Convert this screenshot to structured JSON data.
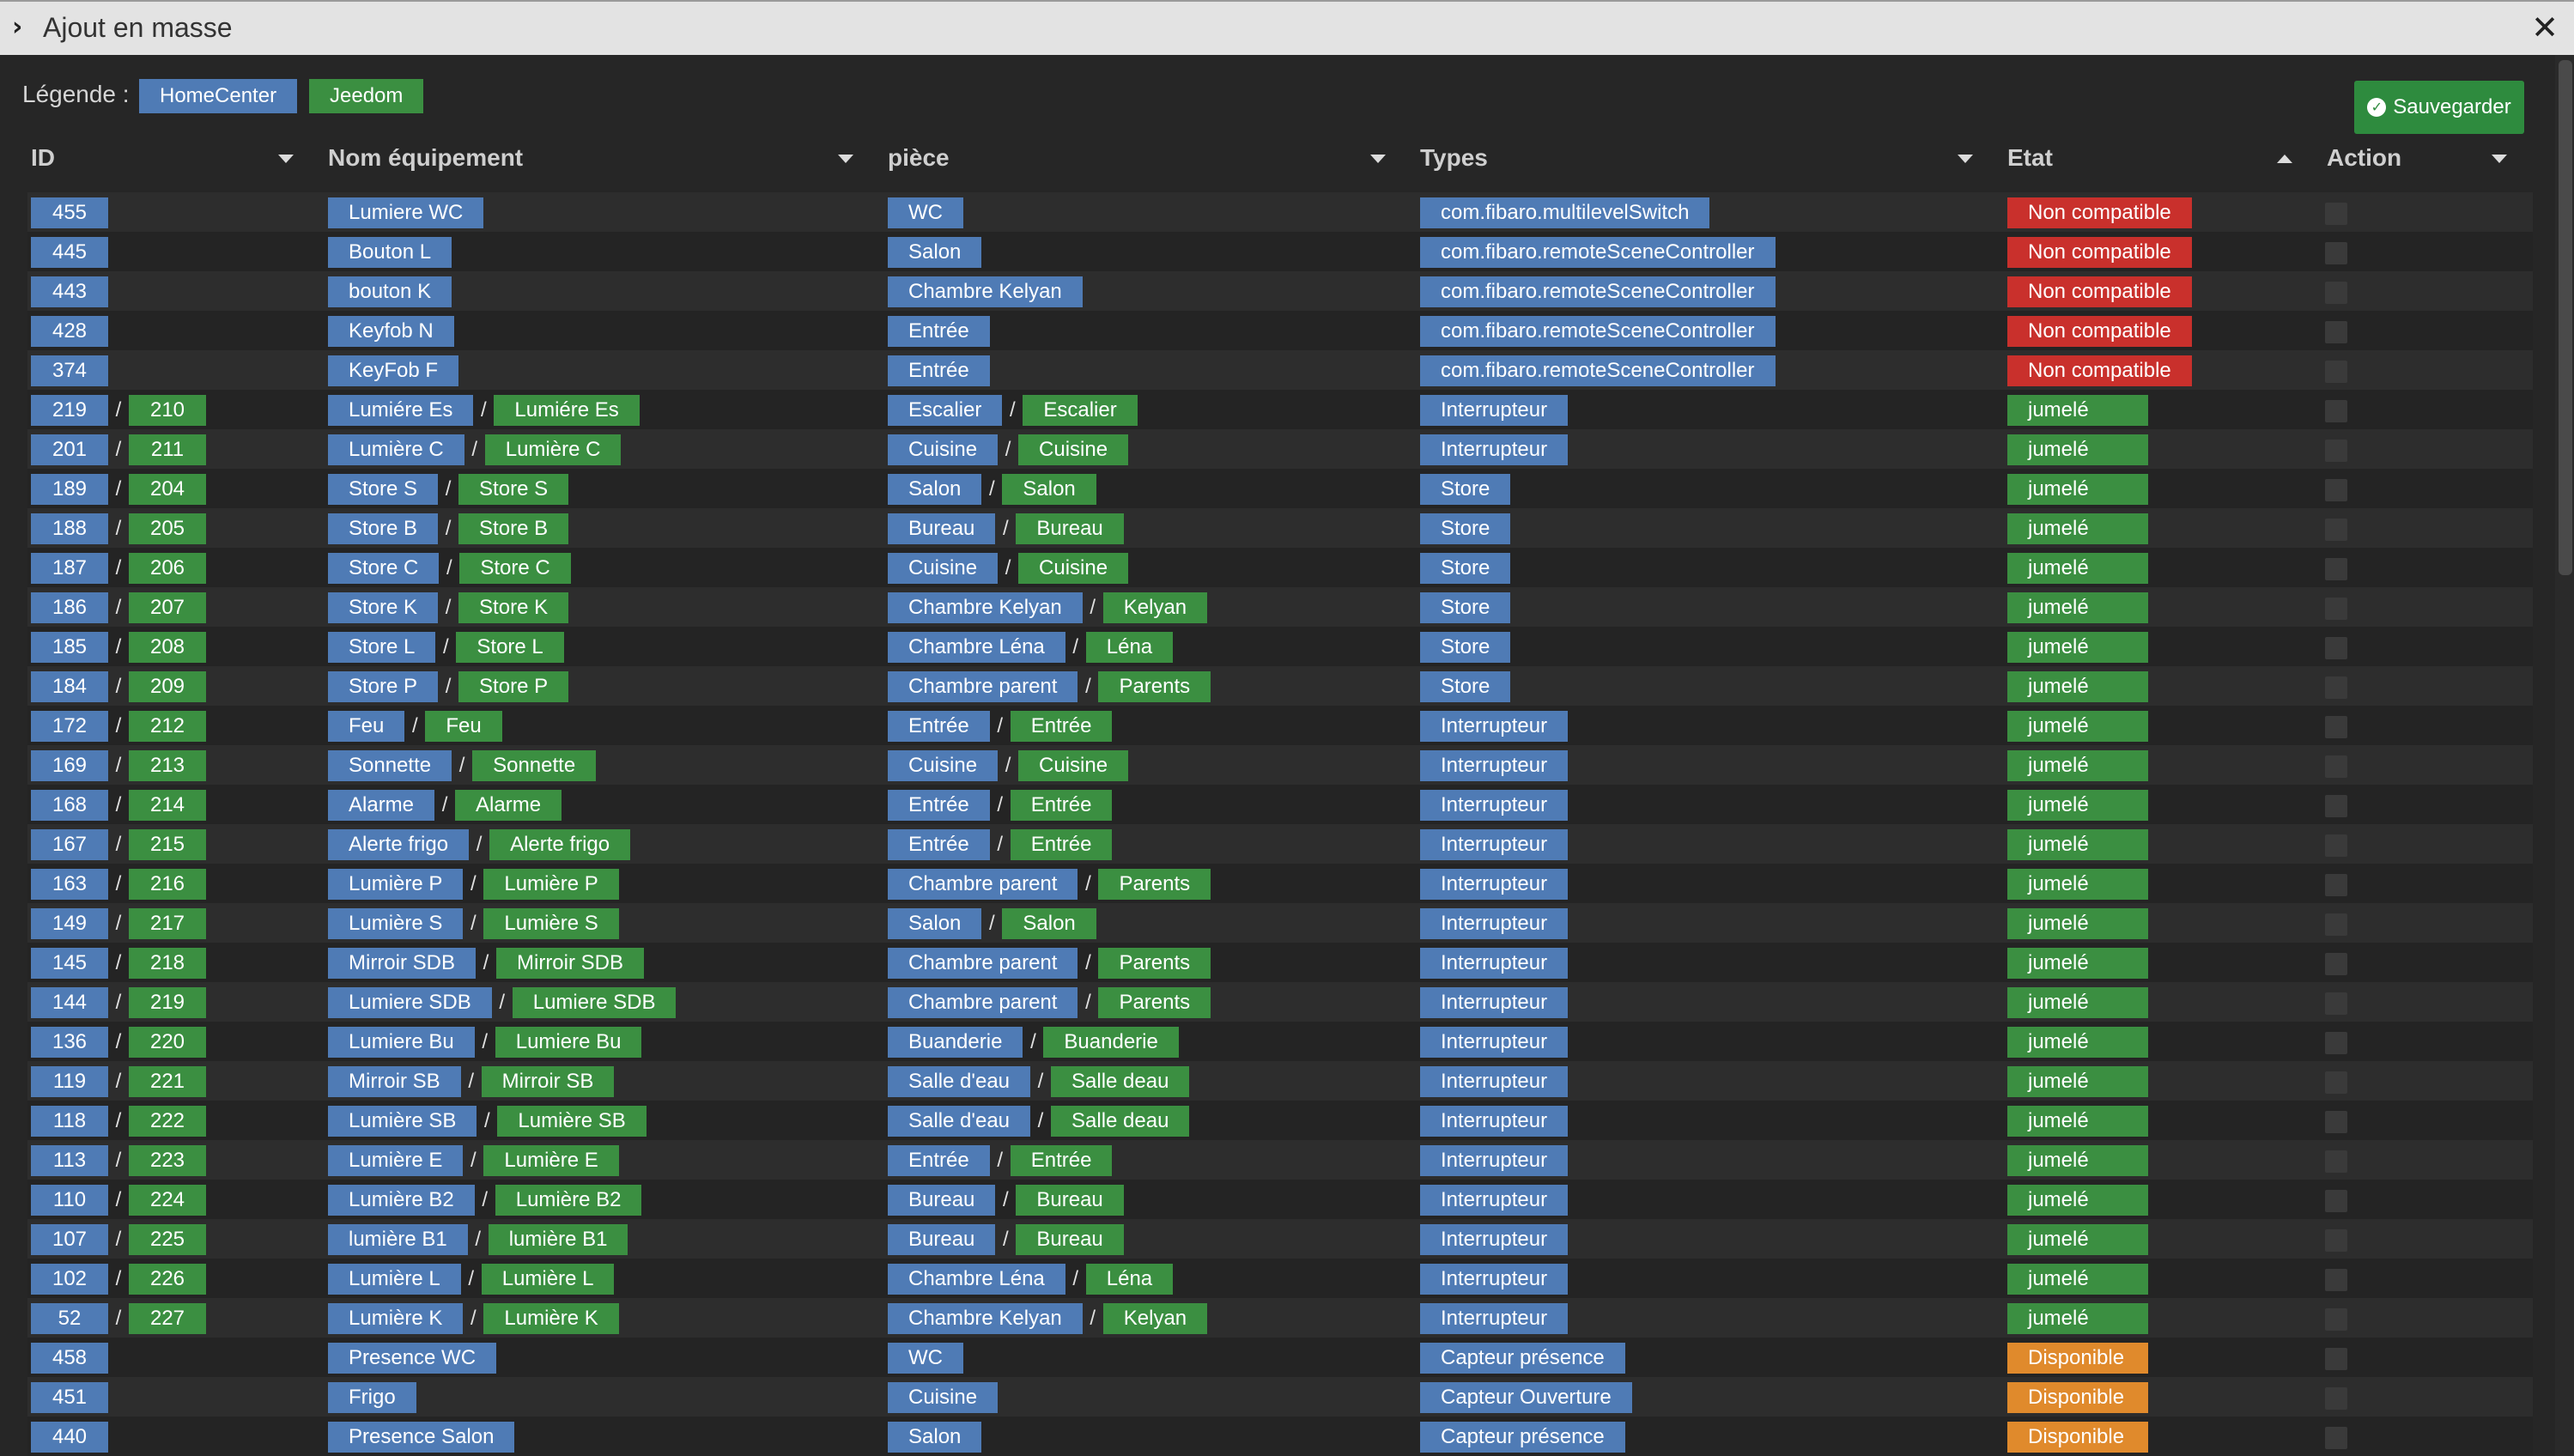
{
  "title": "Ajout en masse",
  "legend": {
    "label": "Légende :",
    "homecenter": "HomeCenter",
    "jeedom": "Jeedom"
  },
  "save_label": "Sauvegarder",
  "columns": {
    "id": "ID",
    "name": "Nom équipement",
    "room": "pièce",
    "types": "Types",
    "state": "Etat",
    "action": "Action"
  },
  "colors": {
    "homecenter": "#4f7bb5",
    "jeedom": "#3b8f41",
    "non_compatible": "#c9302c",
    "jumele": "#3b8f41",
    "disponible": "#e08a2c"
  },
  "rows": [
    {
      "id": "455",
      "name": "Lumiere WC",
      "room": "WC",
      "type": "com.fibaro.multilevelSwitch",
      "state": "Non compatible"
    },
    {
      "id": "445",
      "name": "Bouton L",
      "room": "Salon",
      "type": "com.fibaro.remoteSceneController",
      "state": "Non compatible"
    },
    {
      "id": "443",
      "name": "bouton K",
      "room": "Chambre Kelyan",
      "type": "com.fibaro.remoteSceneController",
      "state": "Non compatible"
    },
    {
      "id": "428",
      "name": "Keyfob N",
      "room": "Entrée",
      "type": "com.fibaro.remoteSceneController",
      "state": "Non compatible"
    },
    {
      "id": "374",
      "name": "KeyFob F",
      "room": "Entrée",
      "type": "com.fibaro.remoteSceneController",
      "state": "Non compatible"
    },
    {
      "id": "219",
      "jid": "210",
      "name": "Lumiére Es",
      "jname": "Lumiére Es",
      "room": "Escalier",
      "jroom": "Escalier",
      "type": "Interrupteur",
      "state": "jumelé"
    },
    {
      "id": "201",
      "jid": "211",
      "name": "Lumière C",
      "jname": "Lumière C",
      "room": "Cuisine",
      "jroom": "Cuisine",
      "type": "Interrupteur",
      "state": "jumelé"
    },
    {
      "id": "189",
      "jid": "204",
      "name": "Store S",
      "jname": "Store S",
      "room": "Salon",
      "jroom": "Salon",
      "type": "Store",
      "state": "jumelé"
    },
    {
      "id": "188",
      "jid": "205",
      "name": "Store B",
      "jname": "Store B",
      "room": "Bureau",
      "jroom": "Bureau",
      "type": "Store",
      "state": "jumelé"
    },
    {
      "id": "187",
      "jid": "206",
      "name": "Store C",
      "jname": "Store C",
      "room": "Cuisine",
      "jroom": "Cuisine",
      "type": "Store",
      "state": "jumelé"
    },
    {
      "id": "186",
      "jid": "207",
      "name": "Store K",
      "jname": "Store K",
      "room": "Chambre Kelyan",
      "jroom": "Kelyan",
      "type": "Store",
      "state": "jumelé"
    },
    {
      "id": "185",
      "jid": "208",
      "name": "Store L",
      "jname": "Store L",
      "room": "Chambre Léna",
      "jroom": "Léna",
      "type": "Store",
      "state": "jumelé"
    },
    {
      "id": "184",
      "jid": "209",
      "name": "Store P",
      "jname": "Store P",
      "room": "Chambre parent",
      "jroom": "Parents",
      "type": "Store",
      "state": "jumelé"
    },
    {
      "id": "172",
      "jid": "212",
      "name": "Feu",
      "jname": "Feu",
      "room": "Entrée",
      "jroom": "Entrée",
      "type": "Interrupteur",
      "state": "jumelé"
    },
    {
      "id": "169",
      "jid": "213",
      "name": "Sonnette",
      "jname": "Sonnette",
      "room": "Cuisine",
      "jroom": "Cuisine",
      "type": "Interrupteur",
      "state": "jumelé"
    },
    {
      "id": "168",
      "jid": "214",
      "name": "Alarme",
      "jname": "Alarme",
      "room": "Entrée",
      "jroom": "Entrée",
      "type": "Interrupteur",
      "state": "jumelé"
    },
    {
      "id": "167",
      "jid": "215",
      "name": "Alerte frigo",
      "jname": "Alerte frigo",
      "room": "Entrée",
      "jroom": "Entrée",
      "type": "Interrupteur",
      "state": "jumelé"
    },
    {
      "id": "163",
      "jid": "216",
      "name": "Lumière P",
      "jname": "Lumière P",
      "room": "Chambre parent",
      "jroom": "Parents",
      "type": "Interrupteur",
      "state": "jumelé"
    },
    {
      "id": "149",
      "jid": "217",
      "name": "Lumière S",
      "jname": "Lumière S",
      "room": "Salon",
      "jroom": "Salon",
      "type": "Interrupteur",
      "state": "jumelé"
    },
    {
      "id": "145",
      "jid": "218",
      "name": "Mirroir SDB",
      "jname": "Mirroir SDB",
      "room": "Chambre parent",
      "jroom": "Parents",
      "type": "Interrupteur",
      "state": "jumelé"
    },
    {
      "id": "144",
      "jid": "219",
      "name": "Lumiere SDB",
      "jname": "Lumiere SDB",
      "room": "Chambre parent",
      "jroom": "Parents",
      "type": "Interrupteur",
      "state": "jumelé"
    },
    {
      "id": "136",
      "jid": "220",
      "name": "Lumiere Bu",
      "jname": "Lumiere Bu",
      "room": "Buanderie",
      "jroom": "Buanderie",
      "type": "Interrupteur",
      "state": "jumelé"
    },
    {
      "id": "119",
      "jid": "221",
      "name": "Mirroir SB",
      "jname": "Mirroir SB",
      "room": "Salle d'eau",
      "jroom": "Salle deau",
      "type": "Interrupteur",
      "state": "jumelé"
    },
    {
      "id": "118",
      "jid": "222",
      "name": "Lumière SB",
      "jname": "Lumière SB",
      "room": "Salle d'eau",
      "jroom": "Salle deau",
      "type": "Interrupteur",
      "state": "jumelé"
    },
    {
      "id": "113",
      "jid": "223",
      "name": "Lumière E",
      "jname": "Lumière E",
      "room": "Entrée",
      "jroom": "Entrée",
      "type": "Interrupteur",
      "state": "jumelé"
    },
    {
      "id": "110",
      "jid": "224",
      "name": "Lumière B2",
      "jname": "Lumière B2",
      "room": "Bureau",
      "jroom": "Bureau",
      "type": "Interrupteur",
      "state": "jumelé"
    },
    {
      "id": "107",
      "jid": "225",
      "name": "lumière B1",
      "jname": "lumière B1",
      "room": "Bureau",
      "jroom": "Bureau",
      "type": "Interrupteur",
      "state": "jumelé"
    },
    {
      "id": "102",
      "jid": "226",
      "name": "Lumière L",
      "jname": "Lumière L",
      "room": "Chambre Léna",
      "jroom": "Léna",
      "type": "Interrupteur",
      "state": "jumelé"
    },
    {
      "id": "52",
      "jid": "227",
      "name": "Lumière K",
      "jname": "Lumière K",
      "room": "Chambre Kelyan",
      "jroom": "Kelyan",
      "type": "Interrupteur",
      "state": "jumelé"
    },
    {
      "id": "458",
      "name": "Presence WC",
      "room": "WC",
      "type": "Capteur présence",
      "state": "Disponible"
    },
    {
      "id": "451",
      "name": "Frigo",
      "room": "Cuisine",
      "type": "Capteur Ouverture",
      "state": "Disponible"
    },
    {
      "id": "440",
      "name": "Presence Salon",
      "room": "Salon",
      "type": "Capteur présence",
      "state": "Disponible"
    }
  ]
}
